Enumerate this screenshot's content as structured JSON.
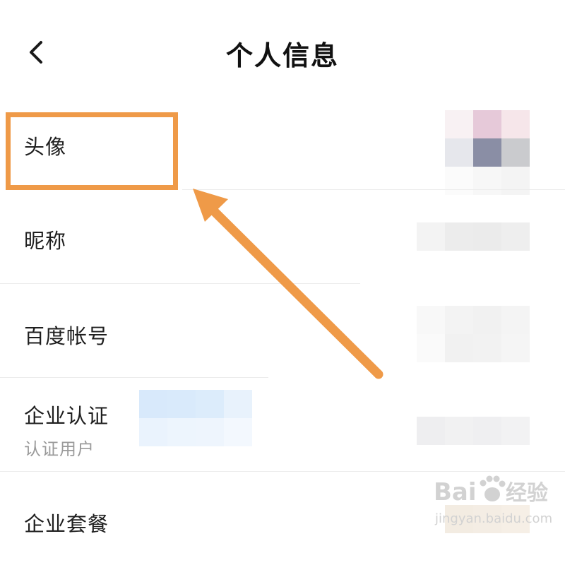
{
  "header": {
    "title": "个人信息",
    "back_icon": "chevron-left-icon"
  },
  "rows": [
    {
      "label": "头像"
    },
    {
      "label": "昵称"
    },
    {
      "label": "百度帐号"
    },
    {
      "label": "企业认证",
      "sublabel": "认证用户"
    },
    {
      "label": "企业套餐"
    }
  ],
  "annotation": {
    "color": "#ef9a48"
  },
  "watermark": {
    "brand_left": "Bai",
    "brand_right": "经验",
    "url": "jingyan.baidu.com"
  }
}
